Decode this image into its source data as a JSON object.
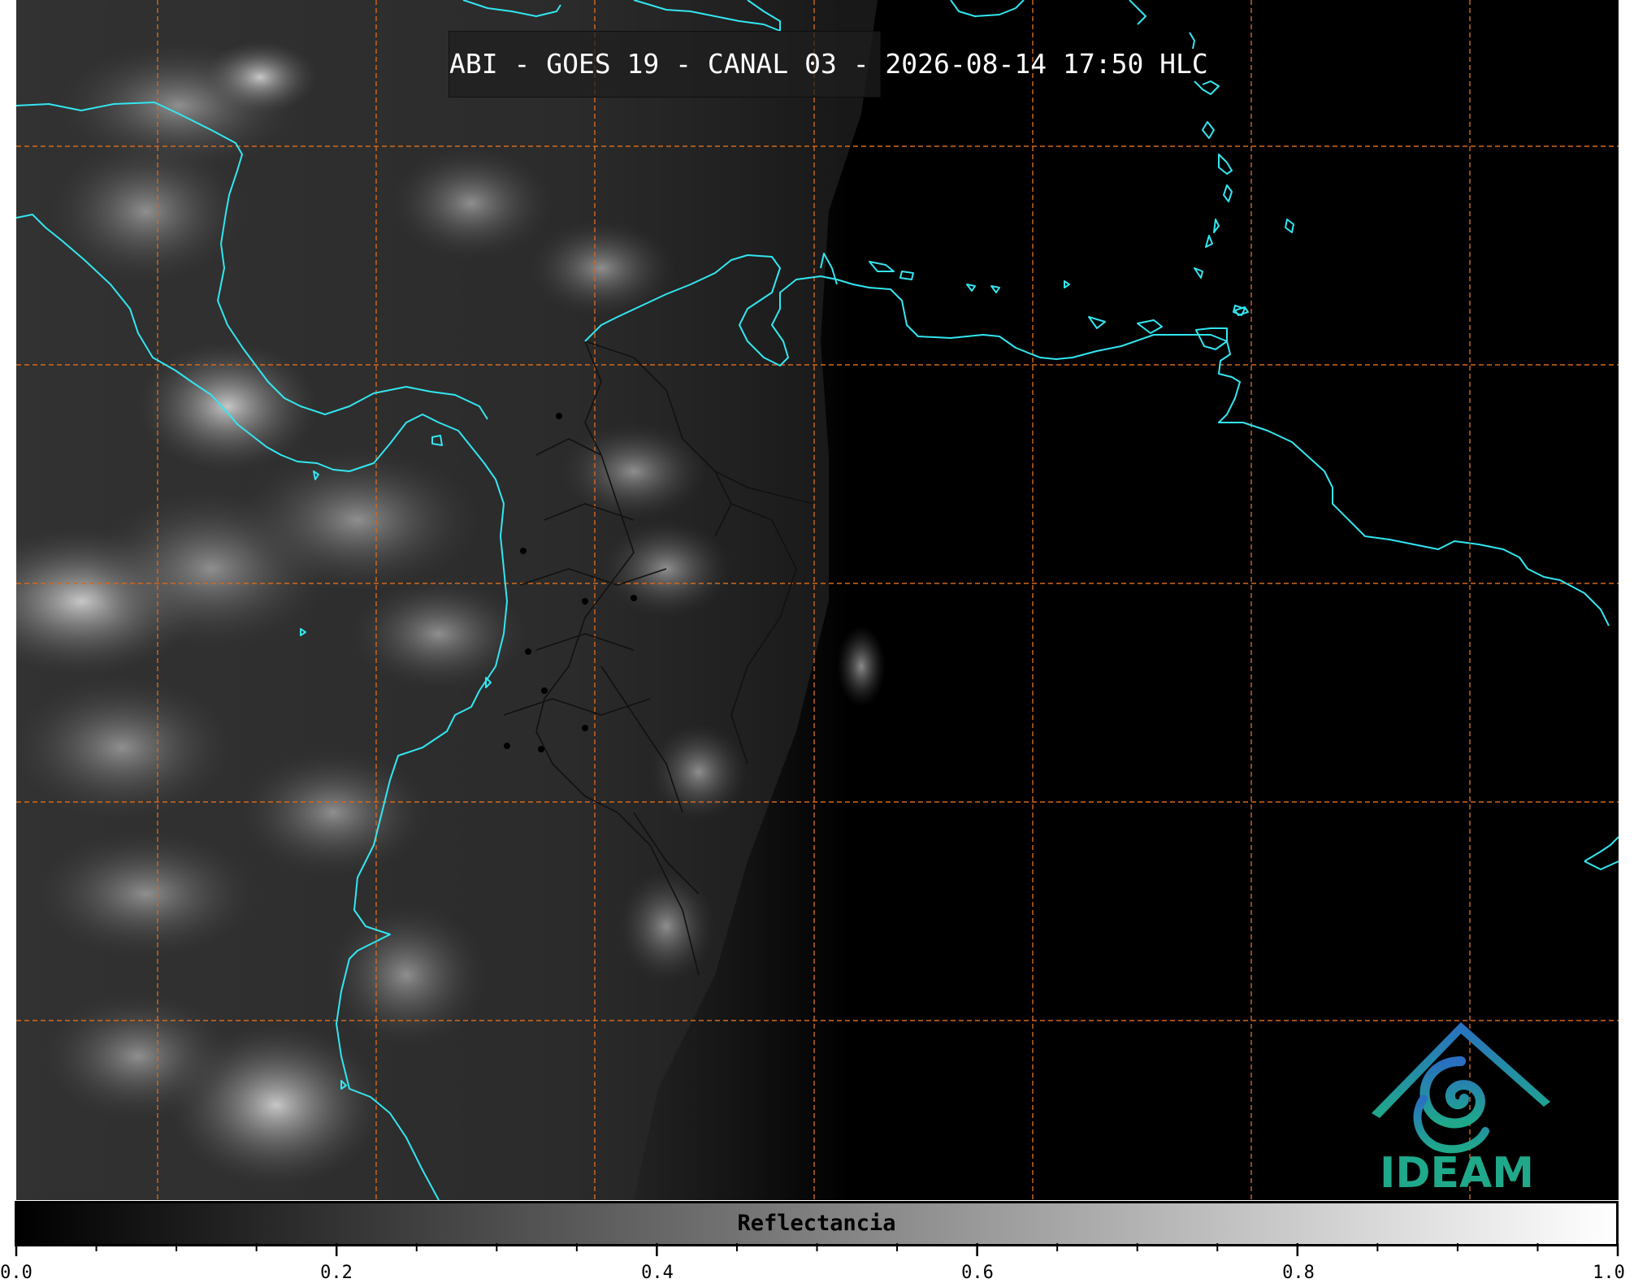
{
  "map": {
    "title": "ABI - GOES 19 - CANAL 03 - 2026-08-14 17:50 HLC",
    "coastline_color": "#33e6f0",
    "gridline_color": "#d2691e",
    "border_color": "#111111",
    "background_color": "#000000"
  },
  "logo": {
    "text": "IDEAM",
    "icon": "ideam-logo-icon",
    "color_primary": "#1fa98a",
    "color_secondary": "#2a7fc0"
  },
  "colorbar": {
    "label": "Reflectancia",
    "min": 0.0,
    "max": 1.0,
    "tick_labels": [
      "0.0",
      "0.2",
      "0.4",
      "0.6",
      "0.8",
      "1.0"
    ]
  }
}
